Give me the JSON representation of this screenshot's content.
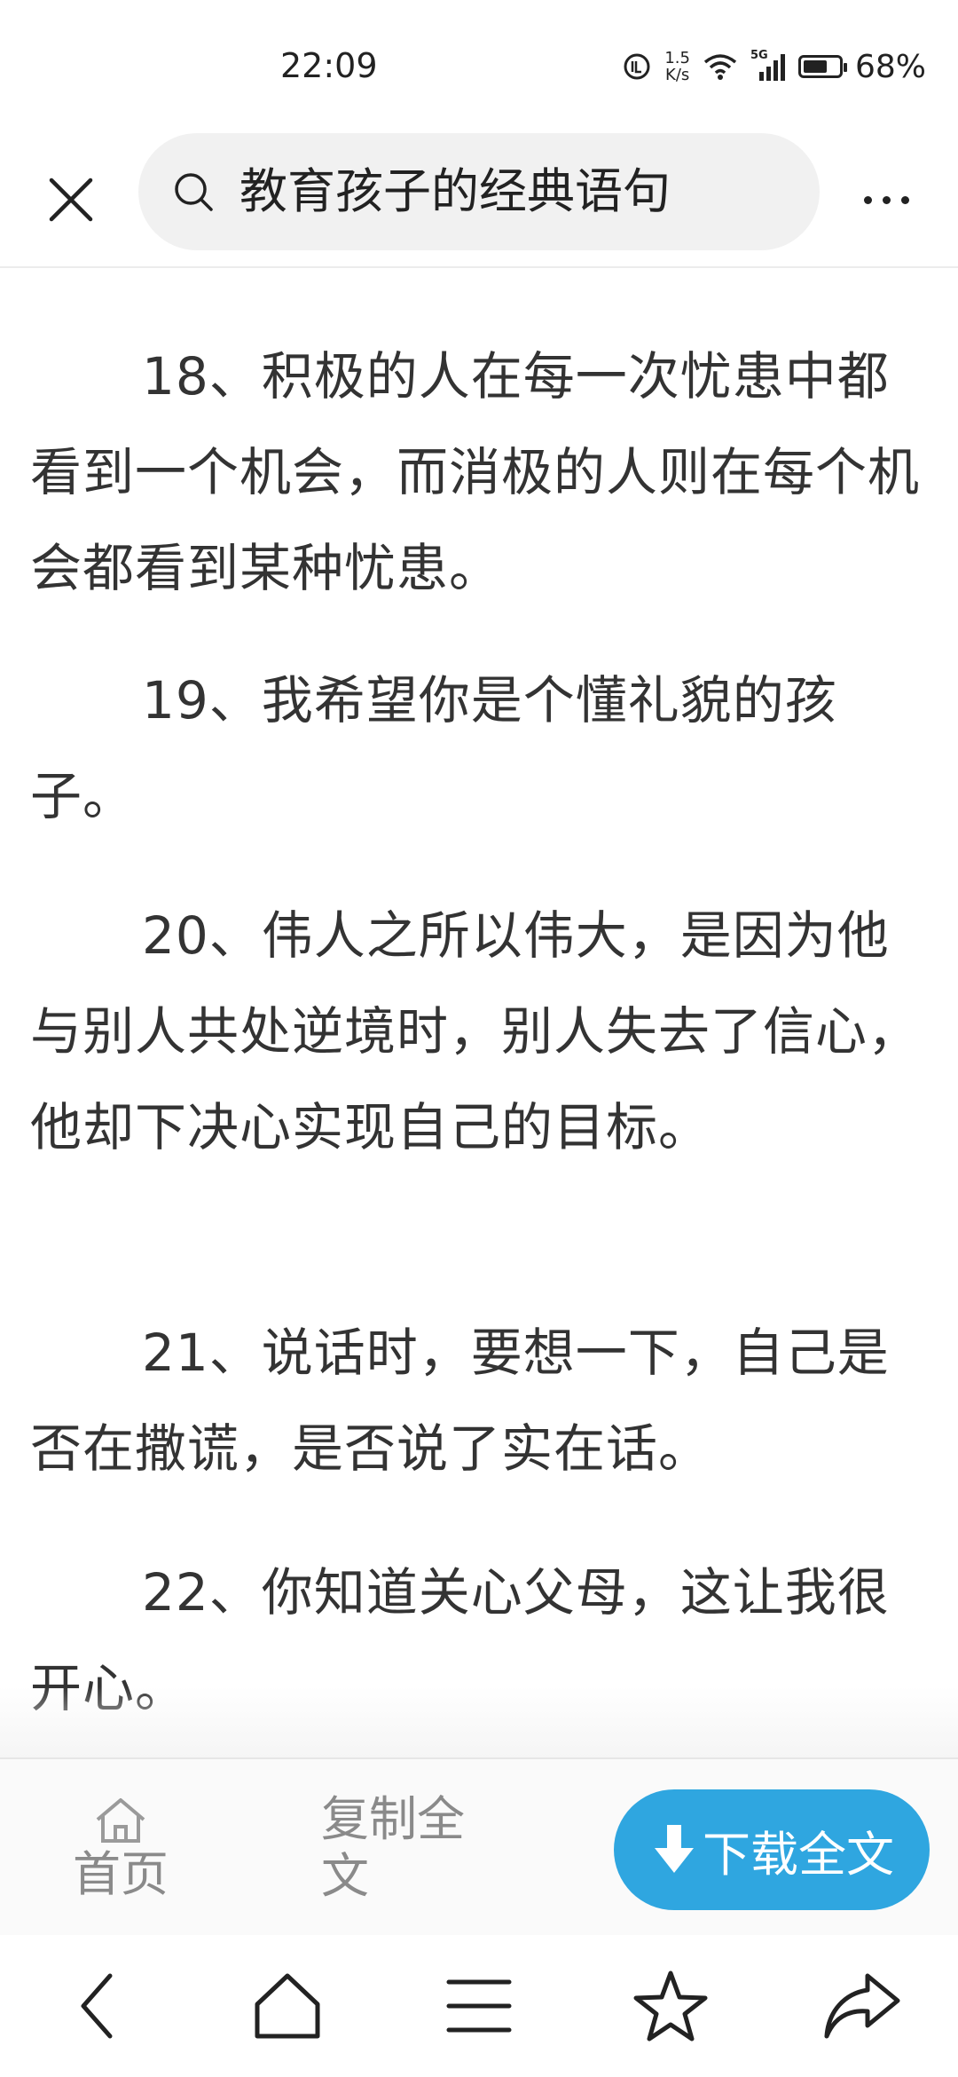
{
  "status_bar": {
    "time": "22:09",
    "net_speed_value": "1.5",
    "net_speed_unit": "K/s",
    "signal_label": "5G",
    "battery_percent": "68%",
    "battery_level": 0.68
  },
  "header": {
    "close_icon": "close-icon",
    "search_icon": "search-icon",
    "search_query": "教育孩子的经典语句",
    "more_icon": "more-dots-icon"
  },
  "article": {
    "paragraphs": [
      {
        "text": "18、积极的人在每一次忧患中都看到一个机会，而消极的人则在每个机会都看到某种忧患。"
      },
      {
        "text": "19、我希望你是个懂礼貌的孩子。"
      },
      {
        "text": "20、伟人之所以伟大，是因为他与别人共处逆境时，别人失去了信心，他却下决心实现自己的目标。"
      },
      {
        "text": "21、说话时，要想一下，自己是否在撒谎，是否说了实在话。"
      },
      {
        "text": "22、你知道关心父母，这让我很开心。"
      }
    ]
  },
  "action_bar": {
    "home_label": "首页",
    "copy_label": "复制全文",
    "download_label": "下载全文",
    "download_color": "#2fa6e0"
  },
  "nav_bar": {
    "icons": [
      "back-icon",
      "home-icon",
      "menu-icon",
      "star-icon",
      "share-icon"
    ]
  }
}
